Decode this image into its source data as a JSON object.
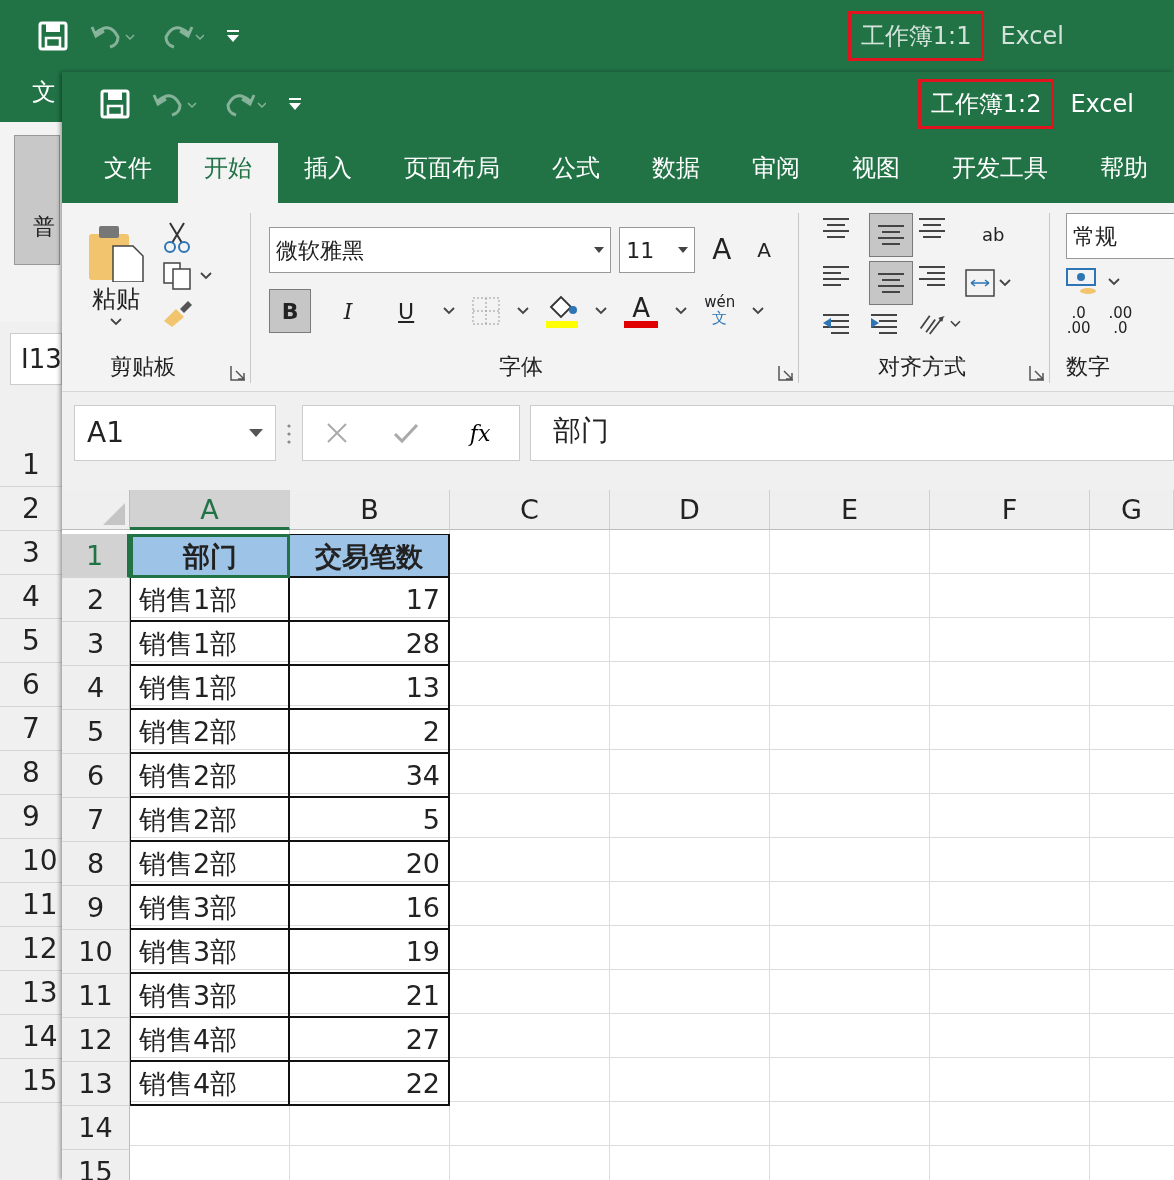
{
  "back_window": {
    "title": "工作簿1:1",
    "app": "Excel",
    "title_highlighted": true,
    "tab_fragment": "文",
    "ribbon_fragment": "普",
    "name_box": "I13",
    "row_numbers": [
      "1",
      "2",
      "3",
      "4",
      "5",
      "6",
      "7",
      "8",
      "9",
      "10",
      "11",
      "12",
      "13",
      "14",
      "15"
    ]
  },
  "front_window": {
    "title": "工作簿1:2",
    "app": "Excel",
    "title_highlighted": true,
    "tabs": [
      {
        "label": "文件",
        "selected": false
      },
      {
        "label": "开始",
        "selected": true
      },
      {
        "label": "插入",
        "selected": false
      },
      {
        "label": "页面布局",
        "selected": false
      },
      {
        "label": "公式",
        "selected": false
      },
      {
        "label": "数据",
        "selected": false
      },
      {
        "label": "审阅",
        "selected": false
      },
      {
        "label": "视图",
        "selected": false
      },
      {
        "label": "开发工具",
        "selected": false
      },
      {
        "label": "帮助",
        "selected": false
      }
    ],
    "ribbon": {
      "paste_label": "粘贴",
      "font_name": "微软雅黑",
      "font_size": "11",
      "grow_label": "A",
      "shrink_label": "A",
      "bold": {
        "label": "B",
        "on": true
      },
      "italic": {
        "label": "I",
        "on": false
      },
      "underline": {
        "label": "U",
        "on": false
      },
      "font_color_label": "A",
      "phonetic_top": "wén",
      "phonetic_bottom": "文",
      "wrap_label": "ab",
      "middle_align_on": true,
      "center_on": true,
      "number_format": "常规",
      "increase_decimal": [
        ".0",
        ".00"
      ],
      "decrease_decimal": [
        ".00",
        ".0"
      ],
      "groups": [
        "剪贴板",
        "字体",
        "对齐方式",
        "数字"
      ]
    },
    "formula_bar": {
      "name_box": "A1",
      "function_label": "fx",
      "content": "部门"
    },
    "columns": [
      {
        "label": "A",
        "selected": true
      },
      {
        "label": "B",
        "selected": false
      },
      {
        "label": "C",
        "selected": false
      },
      {
        "label": "D",
        "selected": false
      },
      {
        "label": "E",
        "selected": false
      },
      {
        "label": "F",
        "selected": false
      },
      {
        "label": "G",
        "selected": false
      }
    ],
    "rows": [
      {
        "number": "1",
        "selected": true,
        "kind": "header",
        "cells": [
          {
            "text": "部门",
            "active": true
          },
          {
            "text": "交易笔数",
            "active": false
          }
        ]
      },
      {
        "number": "2",
        "selected": false,
        "kind": "data",
        "cells": [
          {
            "text": "销售1部",
            "active": false
          },
          {
            "text": "17",
            "active": false
          }
        ]
      },
      {
        "number": "3",
        "selected": false,
        "kind": "data",
        "cells": [
          {
            "text": "销售1部",
            "active": false
          },
          {
            "text": "28",
            "active": false
          }
        ]
      },
      {
        "number": "4",
        "selected": false,
        "kind": "data",
        "cells": [
          {
            "text": "销售1部",
            "active": false
          },
          {
            "text": "13",
            "active": false
          }
        ]
      },
      {
        "number": "5",
        "selected": false,
        "kind": "data",
        "cells": [
          {
            "text": "销售2部",
            "active": false
          },
          {
            "text": "2",
            "active": false
          }
        ]
      },
      {
        "number": "6",
        "selected": false,
        "kind": "data",
        "cells": [
          {
            "text": "销售2部",
            "active": false
          },
          {
            "text": "34",
            "active": false
          }
        ]
      },
      {
        "number": "7",
        "selected": false,
        "kind": "data",
        "cells": [
          {
            "text": "销售2部",
            "active": false
          },
          {
            "text": "5",
            "active": false
          }
        ]
      },
      {
        "number": "8",
        "selected": false,
        "kind": "data",
        "cells": [
          {
            "text": "销售2部",
            "active": false
          },
          {
            "text": "20",
            "active": false
          }
        ]
      },
      {
        "number": "9",
        "selected": false,
        "kind": "data",
        "cells": [
          {
            "text": "销售3部",
            "active": false
          },
          {
            "text": "16",
            "active": false
          }
        ]
      },
      {
        "number": "10",
        "selected": false,
        "kind": "data",
        "cells": [
          {
            "text": "销售3部",
            "active": false
          },
          {
            "text": "19",
            "active": false
          }
        ]
      },
      {
        "number": "11",
        "selected": false,
        "kind": "data",
        "cells": [
          {
            "text": "销售3部",
            "active": false
          },
          {
            "text": "21",
            "active": false
          }
        ]
      },
      {
        "number": "12",
        "selected": false,
        "kind": "data",
        "cells": [
          {
            "text": "销售4部",
            "active": false
          },
          {
            "text": "27",
            "active": false
          }
        ]
      },
      {
        "number": "13",
        "selected": false,
        "kind": "data",
        "cells": [
          {
            "text": "销售4部",
            "active": false
          },
          {
            "text": "22",
            "active": false
          }
        ]
      },
      {
        "number": "14",
        "selected": false,
        "kind": "empty"
      },
      {
        "number": "15",
        "selected": false,
        "kind": "empty"
      }
    ]
  }
}
